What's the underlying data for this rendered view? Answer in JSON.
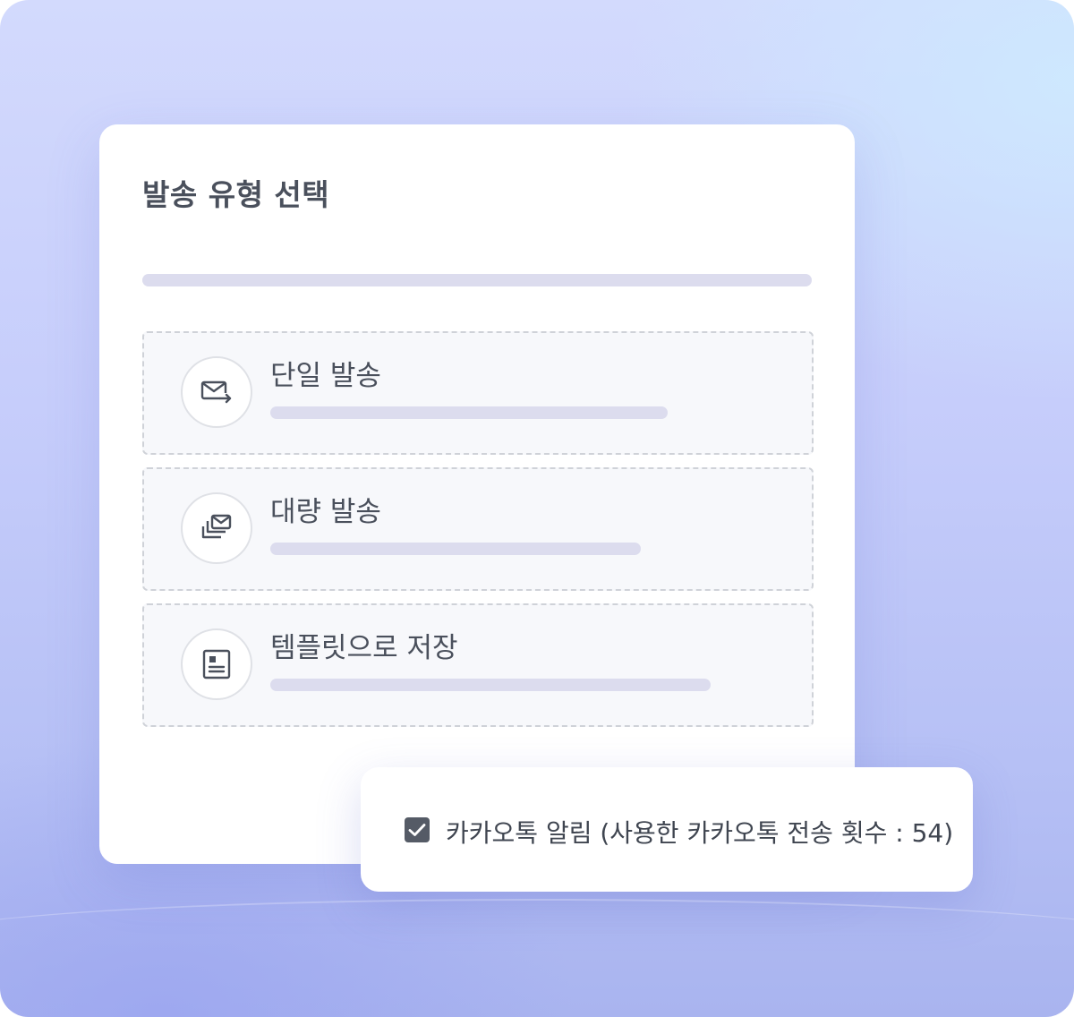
{
  "card": {
    "title": "발송 유형 선택"
  },
  "options": [
    {
      "label": "단일 발송",
      "icon": "mail-send-icon"
    },
    {
      "label": "대량 발송",
      "icon": "bulk-mail-icon"
    },
    {
      "label": "템플릿으로 저장",
      "icon": "template-icon"
    }
  ],
  "notification": {
    "checked": true,
    "label": "카카오톡 알림 (사용한 카카오톡 전송 횟수 : 54)"
  },
  "colors": {
    "text": "#4a505c",
    "placeholder_bar": "#dcdcee",
    "checkbox": "#555b66"
  }
}
